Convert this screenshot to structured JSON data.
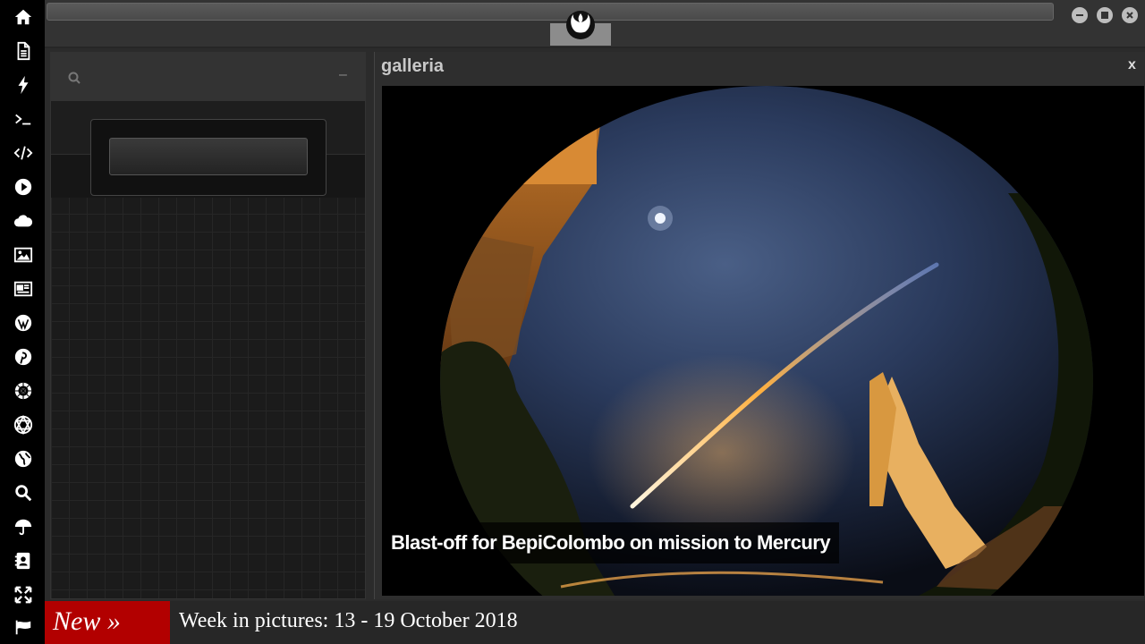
{
  "sidebar": {
    "icons": [
      "home-icon",
      "document-icon",
      "bolt-icon",
      "terminal-icon",
      "code-icon",
      "play-icon",
      "cloud-icon",
      "image-icon",
      "newspaper-icon",
      "wordpress-icon",
      "pinterest-icon",
      "galactic-empire-icon",
      "jedi-order-icon",
      "globe-icon",
      "search-icon",
      "umbrella-icon",
      "address-card-icon",
      "expand-icon",
      "flag-icon"
    ]
  },
  "topbar": {
    "logo": "rebel-alliance-icon",
    "window_buttons": [
      "minimize-icon",
      "maximize-icon",
      "close-icon"
    ]
  },
  "left_panel": {
    "search_icon": "search-icon",
    "minimize_label": "–"
  },
  "gallery": {
    "title": "galleria",
    "close_label": "x",
    "caption": "Blast-off for BepiColombo on mission to Mercury"
  },
  "ticker": {
    "badge": "New »",
    "headline": "Week in pictures: 13 - 19 October 2018"
  },
  "colors": {
    "sidebar_bg": "#000000",
    "ticker_badge": "#b20000",
    "panel_bg": "#333333"
  }
}
